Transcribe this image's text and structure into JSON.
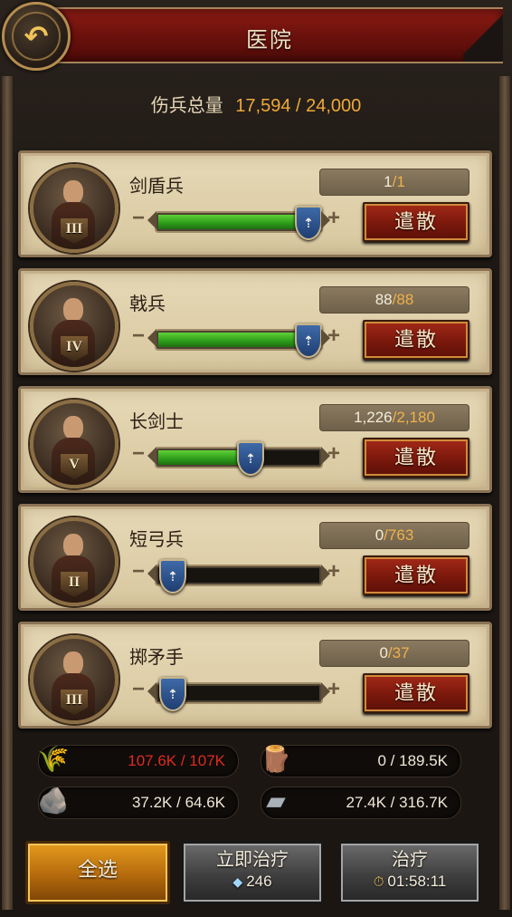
{
  "header": {
    "title": "医院"
  },
  "total": {
    "label": "伤兵总量",
    "value": "17,594 / 24,000"
  },
  "troops": [
    {
      "name": "剑盾兵",
      "rank": "III",
      "current": "1",
      "max": "1",
      "heal_fraction": 1.0,
      "dismiss_label": "遣散"
    },
    {
      "name": "戟兵",
      "rank": "IV",
      "current": "88",
      "max": "88",
      "heal_fraction": 1.0,
      "dismiss_label": "遣散"
    },
    {
      "name": "长剑士",
      "rank": "V",
      "current": "1,226",
      "max": "2,180",
      "heal_fraction": 0.56,
      "dismiss_label": "遣散"
    },
    {
      "name": "短弓兵",
      "rank": "II",
      "current": "0",
      "max": "763",
      "heal_fraction": 0.0,
      "dismiss_label": "遣散"
    },
    {
      "name": "掷矛手",
      "rank": "III",
      "current": "0",
      "max": "37",
      "heal_fraction": 0.0,
      "dismiss_label": "遣散"
    }
  ],
  "resources": {
    "food": {
      "value": "107.6K / 107K",
      "icon": "food-icon",
      "color": "#e02a1e"
    },
    "wood": {
      "value": "0 / 189.5K",
      "icon": "wood-icon"
    },
    "stone": {
      "value": "37.2K / 64.6K",
      "icon": "stone-icon"
    },
    "iron": {
      "value": "27.4K / 316.7K",
      "icon": "iron-icon"
    }
  },
  "buttons": {
    "select_all": "全选",
    "instant_heal": {
      "label": "立即治疗",
      "cost": "246",
      "icon": "gem-icon"
    },
    "heal": {
      "label": "治疗",
      "time": "01:58:11",
      "icon": "clock-icon"
    }
  },
  "colors": {
    "accent": "#f0a83a",
    "header_red": "#8e1b14",
    "fill_green": "#2c9a1a"
  }
}
